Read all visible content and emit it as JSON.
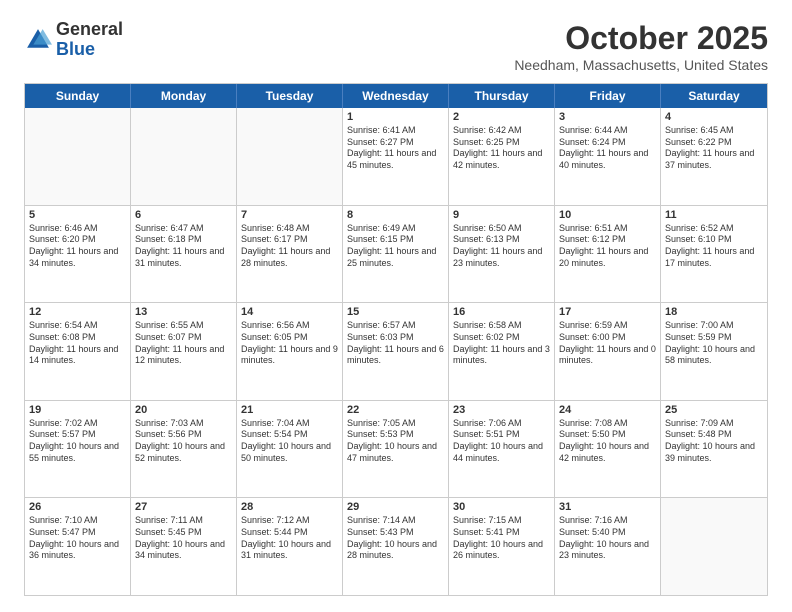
{
  "header": {
    "logo_general": "General",
    "logo_blue": "Blue",
    "month_title": "October 2025",
    "location": "Needham, Massachusetts, United States"
  },
  "day_headers": [
    "Sunday",
    "Monday",
    "Tuesday",
    "Wednesday",
    "Thursday",
    "Friday",
    "Saturday"
  ],
  "weeks": [
    [
      {
        "day": "",
        "empty": true
      },
      {
        "day": "",
        "empty": true
      },
      {
        "day": "",
        "empty": true
      },
      {
        "day": "1",
        "sunrise": "6:41 AM",
        "sunset": "6:27 PM",
        "daylight": "11 hours and 45 minutes."
      },
      {
        "day": "2",
        "sunrise": "6:42 AM",
        "sunset": "6:25 PM",
        "daylight": "11 hours and 42 minutes."
      },
      {
        "day": "3",
        "sunrise": "6:44 AM",
        "sunset": "6:24 PM",
        "daylight": "11 hours and 40 minutes."
      },
      {
        "day": "4",
        "sunrise": "6:45 AM",
        "sunset": "6:22 PM",
        "daylight": "11 hours and 37 minutes."
      }
    ],
    [
      {
        "day": "5",
        "sunrise": "6:46 AM",
        "sunset": "6:20 PM",
        "daylight": "11 hours and 34 minutes."
      },
      {
        "day": "6",
        "sunrise": "6:47 AM",
        "sunset": "6:18 PM",
        "daylight": "11 hours and 31 minutes."
      },
      {
        "day": "7",
        "sunrise": "6:48 AM",
        "sunset": "6:17 PM",
        "daylight": "11 hours and 28 minutes."
      },
      {
        "day": "8",
        "sunrise": "6:49 AM",
        "sunset": "6:15 PM",
        "daylight": "11 hours and 25 minutes."
      },
      {
        "day": "9",
        "sunrise": "6:50 AM",
        "sunset": "6:13 PM",
        "daylight": "11 hours and 23 minutes."
      },
      {
        "day": "10",
        "sunrise": "6:51 AM",
        "sunset": "6:12 PM",
        "daylight": "11 hours and 20 minutes."
      },
      {
        "day": "11",
        "sunrise": "6:52 AM",
        "sunset": "6:10 PM",
        "daylight": "11 hours and 17 minutes."
      }
    ],
    [
      {
        "day": "12",
        "sunrise": "6:54 AM",
        "sunset": "6:08 PM",
        "daylight": "11 hours and 14 minutes."
      },
      {
        "day": "13",
        "sunrise": "6:55 AM",
        "sunset": "6:07 PM",
        "daylight": "11 hours and 12 minutes."
      },
      {
        "day": "14",
        "sunrise": "6:56 AM",
        "sunset": "6:05 PM",
        "daylight": "11 hours and 9 minutes."
      },
      {
        "day": "15",
        "sunrise": "6:57 AM",
        "sunset": "6:03 PM",
        "daylight": "11 hours and 6 minutes."
      },
      {
        "day": "16",
        "sunrise": "6:58 AM",
        "sunset": "6:02 PM",
        "daylight": "11 hours and 3 minutes."
      },
      {
        "day": "17",
        "sunrise": "6:59 AM",
        "sunset": "6:00 PM",
        "daylight": "11 hours and 0 minutes."
      },
      {
        "day": "18",
        "sunrise": "7:00 AM",
        "sunset": "5:59 PM",
        "daylight": "10 hours and 58 minutes."
      }
    ],
    [
      {
        "day": "19",
        "sunrise": "7:02 AM",
        "sunset": "5:57 PM",
        "daylight": "10 hours and 55 minutes."
      },
      {
        "day": "20",
        "sunrise": "7:03 AM",
        "sunset": "5:56 PM",
        "daylight": "10 hours and 52 minutes."
      },
      {
        "day": "21",
        "sunrise": "7:04 AM",
        "sunset": "5:54 PM",
        "daylight": "10 hours and 50 minutes."
      },
      {
        "day": "22",
        "sunrise": "7:05 AM",
        "sunset": "5:53 PM",
        "daylight": "10 hours and 47 minutes."
      },
      {
        "day": "23",
        "sunrise": "7:06 AM",
        "sunset": "5:51 PM",
        "daylight": "10 hours and 44 minutes."
      },
      {
        "day": "24",
        "sunrise": "7:08 AM",
        "sunset": "5:50 PM",
        "daylight": "10 hours and 42 minutes."
      },
      {
        "day": "25",
        "sunrise": "7:09 AM",
        "sunset": "5:48 PM",
        "daylight": "10 hours and 39 minutes."
      }
    ],
    [
      {
        "day": "26",
        "sunrise": "7:10 AM",
        "sunset": "5:47 PM",
        "daylight": "10 hours and 36 minutes."
      },
      {
        "day": "27",
        "sunrise": "7:11 AM",
        "sunset": "5:45 PM",
        "daylight": "10 hours and 34 minutes."
      },
      {
        "day": "28",
        "sunrise": "7:12 AM",
        "sunset": "5:44 PM",
        "daylight": "10 hours and 31 minutes."
      },
      {
        "day": "29",
        "sunrise": "7:14 AM",
        "sunset": "5:43 PM",
        "daylight": "10 hours and 28 minutes."
      },
      {
        "day": "30",
        "sunrise": "7:15 AM",
        "sunset": "5:41 PM",
        "daylight": "10 hours and 26 minutes."
      },
      {
        "day": "31",
        "sunrise": "7:16 AM",
        "sunset": "5:40 PM",
        "daylight": "10 hours and 23 minutes."
      },
      {
        "day": "",
        "empty": true
      }
    ]
  ]
}
